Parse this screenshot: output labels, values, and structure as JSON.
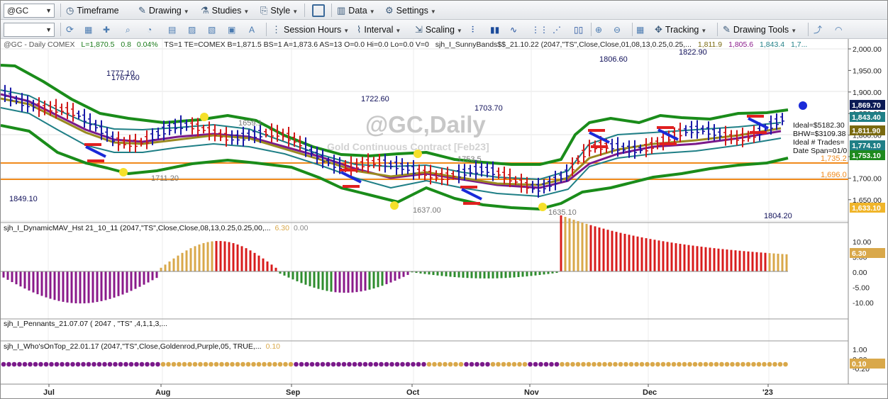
{
  "toolbar1": {
    "symbol": "@GC",
    "items": [
      "Timeframe",
      "Drawing",
      "Studies",
      "Style",
      "Data",
      "Settings"
    ]
  },
  "toolbar2": {
    "items": [
      "Session Hours",
      "Interval",
      "Scaling",
      "Tracking",
      "Drawing Tools"
    ]
  },
  "header": {
    "symbol_line": "@GC - Daily  COMEX",
    "L": "L=1,870.5",
    "chg": "0.8",
    "pct": "0.04%",
    "rest": "TS=1  TE=COMEX  B=1,871.5  BS=1  A=1,873.6  AS=13  O=0.0  Hi=0.0  Lo=0.0  V=0",
    "study": "sjh_I_SunnyBands$$_21.10.22 (2047,\"TS\",Close,Close,01,08,13,0.25,0.25,...",
    "v1": "1,811.9",
    "v2": "1,805.6",
    "v3": "1,843.4",
    "v4": "1,7..."
  },
  "watermark": {
    "title": "@GC,Daily",
    "subtitle": "Gold Continuous Contract [Feb23]"
  },
  "price_annotations": [
    "1777.10",
    "1767.60",
    "1722.60",
    "1703.70",
    "1806.60",
    "1822.90",
    "1849.10",
    "1711.20",
    "1659.1",
    "1753.5",
    "1637.00",
    "1635.10",
    "1804.20"
  ],
  "ideal_box": [
    "Ideal=$5182.30",
    "BHW=$3109.38",
    "Ideal # Trades=",
    "Date Span=01/0"
  ],
  "hlines": {
    "h1": "1,735.2",
    "h2": "1,696.0"
  },
  "price_axis": {
    "ticks": [
      "2,000.00",
      "1,950.00",
      "1,900.00",
      "1,850.00",
      "1,800.00",
      "1,750.00",
      "1,700.00",
      "1,650.00"
    ],
    "badges": [
      {
        "text": "1,869.70",
        "bg": "#0a1a55"
      },
      {
        "text": "1,843.40",
        "bg": "#1f7f86"
      },
      {
        "text": "1,811.90",
        "bg": "#7a6a10"
      },
      {
        "text": "1,774.10",
        "bg": "#1f7f86"
      },
      {
        "text": "1,753.10",
        "bg": "#1e8a1e"
      },
      {
        "text": "1,633.10",
        "bg": "#f0b52a"
      }
    ]
  },
  "panel2": {
    "label": "sjh_I_DynamicMAV_Hst 21_10_11 (2047,\"TS\",Close,Close,08,13,0.25,0.25,00,...",
    "v1": "6.30",
    "v2": "0.00",
    "ticks": [
      "10.00",
      "5.00",
      "0.00",
      "-5.00",
      "-10.00"
    ],
    "badge": "6.30"
  },
  "panel3": {
    "label": "sjh_I_Pennants_21.07.07 ( 2047 , \"TS\" ,4,1,1,3,..."
  },
  "panel4": {
    "label": "sjh_I_Who'sOnTop_22.01.17 (2047,\"TS\",Close,Goldenrod,Purple,05, TRUE,...",
    "v1": "0.10",
    "ticks": [
      "1.00",
      "0.00",
      "-0.20"
    ],
    "badge": "0.10"
  },
  "time_axis": [
    "Jul",
    "Aug",
    "Sep",
    "Oct",
    "Nov",
    "Dec",
    "'23"
  ],
  "colors": {
    "up": "#1a1aa8",
    "down": "#d01818",
    "outer_band": "#1a8c1a",
    "inner_band": "#1f7f86",
    "ma_purple": "#7a1a8a",
    "ma_gold": "#9a8a20",
    "hist_red": "#d81c1c",
    "hist_gold": "#d9a84a",
    "hist_green": "#2e8c2e",
    "hist_purple": "#8a1a8a"
  }
}
